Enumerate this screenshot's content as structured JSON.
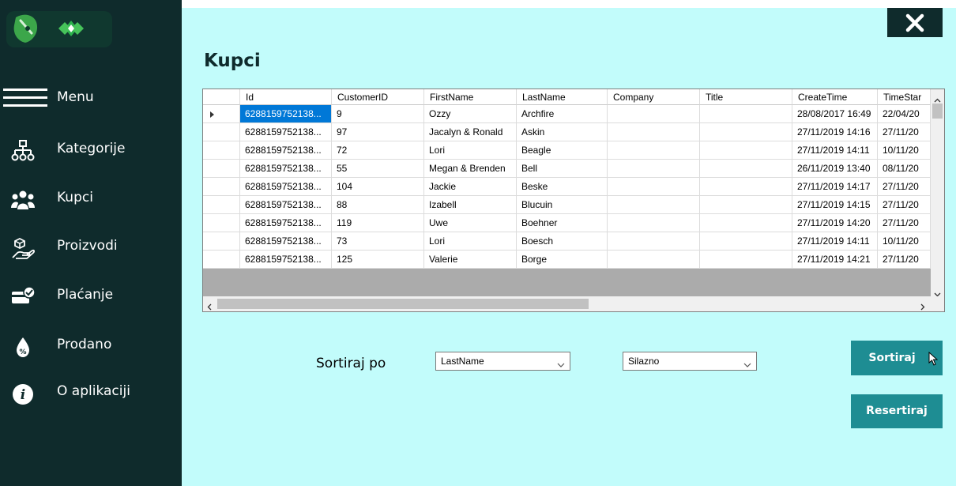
{
  "sidebar": {
    "menu_label": "Menu",
    "items": [
      {
        "label": "Kategorije",
        "icon": "sitemap-icon"
      },
      {
        "label": "Kupci",
        "icon": "users-icon"
      },
      {
        "label": "Proizvodi",
        "icon": "product-hand-icon"
      },
      {
        "label": "Plaćanje",
        "icon": "payment-check-icon"
      },
      {
        "label": "Prodano",
        "icon": "sold-percent-icon"
      },
      {
        "label": "O aplikaciji",
        "icon": "info-icon"
      }
    ]
  },
  "header": {
    "title": "Kupci",
    "close_icon": "close-icon"
  },
  "grid": {
    "columns": [
      "Id",
      "CustomerID",
      "FirstName",
      "LastName",
      "Company",
      "Title",
      "CreateTime",
      "TimeStar"
    ],
    "rows": [
      [
        "6288159752138...",
        "9",
        "Ozzy",
        "Archfire",
        "",
        "",
        "28/08/2017 16:49",
        "22/04/20"
      ],
      [
        "6288159752138...",
        "97",
        "Jacalyn & Ronald",
        "Askin",
        "",
        "",
        "27/11/2019 14:16",
        "27/11/20"
      ],
      [
        "6288159752138...",
        "72",
        "Lori",
        "Beagle",
        "",
        "",
        "27/11/2019 14:11",
        "10/11/20"
      ],
      [
        "6288159752138...",
        "55",
        "Megan & Brenden",
        "Bell",
        "",
        "",
        "26/11/2019 13:40",
        "08/11/20"
      ],
      [
        "6288159752138...",
        "104",
        "Jackie",
        "Beske",
        "",
        "",
        "27/11/2019 14:17",
        "27/11/20"
      ],
      [
        "6288159752138...",
        "88",
        "Izabell",
        "Blucuin",
        "",
        "",
        "27/11/2019 14:15",
        "27/11/20"
      ],
      [
        "6288159752138...",
        "119",
        "Uwe",
        "Boehner",
        "",
        "",
        "27/11/2019 14:20",
        "27/11/20"
      ],
      [
        "6288159752138...",
        "73",
        "Lori",
        "Boesch",
        "",
        "",
        "27/11/2019 14:11",
        "10/11/20"
      ],
      [
        "6288159752138...",
        "125",
        "Valerie",
        "Borge",
        "",
        "",
        "27/11/2019 14:21",
        "27/11/20"
      ]
    ]
  },
  "sort": {
    "label": "Sortiraj po",
    "field_value": "LastName",
    "order_value": "Silazno",
    "sort_button": "Sortiraj",
    "reset_button": "Resertiraj"
  },
  "colors": {
    "sidebar_bg": "#0f2b2c",
    "main_bg": "#c2fcfb",
    "button_bg": "#1e8d93",
    "selection": "#0078d7"
  }
}
